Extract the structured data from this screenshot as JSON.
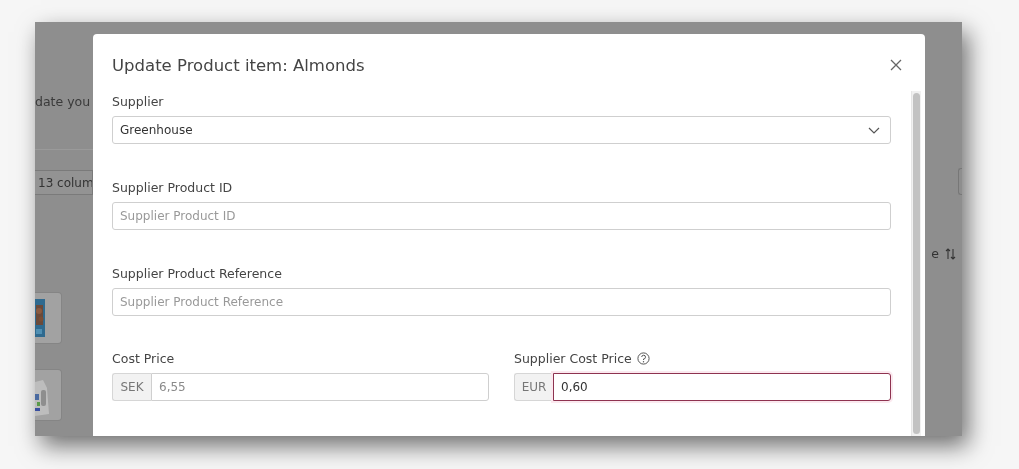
{
  "background": {
    "intro_text": "date you",
    "columns_button": "13 colum",
    "sort_header": "e"
  },
  "modal": {
    "title": "Update Product item: Almonds",
    "fields": [
      {
        "kind": "select",
        "label": "Supplier",
        "value": "Greenhouse"
      },
      {
        "kind": "text",
        "label": "Supplier Product ID",
        "placeholder": "Supplier Product ID"
      },
      {
        "kind": "text",
        "label": "Supplier Product Reference",
        "placeholder": "Supplier Product Reference"
      }
    ],
    "price_fields": [
      {
        "label": "Cost Price",
        "currency": "SEK",
        "value": "6,55",
        "disabled": true,
        "invalid": false,
        "help": false
      },
      {
        "label": "Supplier Cost Price",
        "currency": "EUR",
        "value": "0,60",
        "disabled": false,
        "invalid": true,
        "help": true
      }
    ]
  }
}
